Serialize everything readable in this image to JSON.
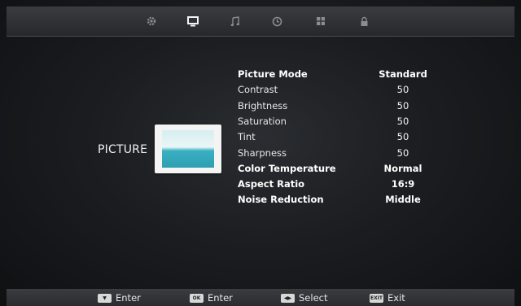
{
  "menu": {
    "tabs": [
      {
        "name": "settings-gear",
        "icon": "gear-icon"
      },
      {
        "name": "picture",
        "icon": "monitor-icon",
        "active": true
      },
      {
        "name": "sound",
        "icon": "music-note-icon"
      },
      {
        "name": "time",
        "icon": "clock-icon"
      },
      {
        "name": "apps",
        "icon": "grid-icon"
      },
      {
        "name": "lock",
        "icon": "lock-icon"
      }
    ]
  },
  "category": {
    "label": "PICTURE",
    "icon": "picture-thumbnail-icon"
  },
  "items": [
    {
      "label": "Picture Mode",
      "value": "Standard",
      "bold": true
    },
    {
      "label": "Contrast",
      "value": "50"
    },
    {
      "label": "Brightness",
      "value": "50"
    },
    {
      "label": "Saturation",
      "value": "50"
    },
    {
      "label": "Tint",
      "value": "50"
    },
    {
      "label": "Sharpness",
      "value": "50"
    },
    {
      "label": "Color Temperature",
      "value": "Normal",
      "bold": true
    },
    {
      "label": "Aspect Ratio",
      "value": "16:9",
      "bold": true
    },
    {
      "label": "Noise Reduction",
      "value": "Middle",
      "bold": true
    }
  ],
  "footer": {
    "hints": [
      {
        "key_label": "▼",
        "text": "Enter"
      },
      {
        "key_label": "OK",
        "text": "Enter"
      },
      {
        "key_label": "◀▶",
        "text": "Select"
      },
      {
        "key_label": "EXIT",
        "text": "Exit"
      }
    ]
  }
}
